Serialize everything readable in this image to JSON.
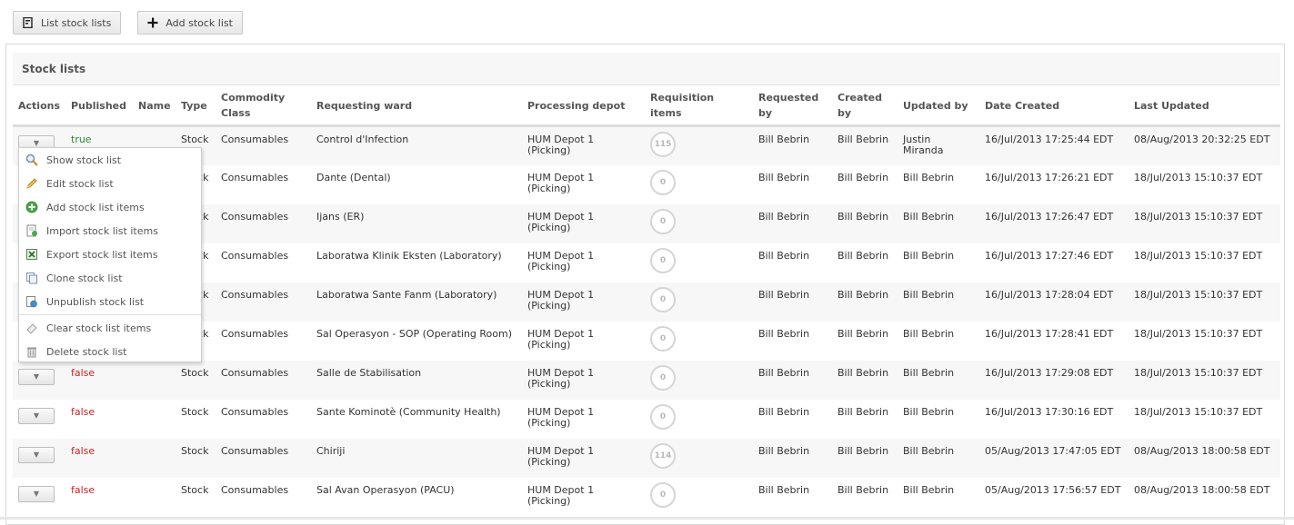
{
  "toolbar": {
    "list_label": "List stock lists",
    "add_label": "Add stock list"
  },
  "panel": {
    "title": "Stock lists"
  },
  "columns": {
    "actions": "Actions",
    "published": "Published",
    "name": "Name",
    "type": "Type",
    "commodity_class": "Commodity Class",
    "requesting_ward": "Requesting ward",
    "processing_depot": "Processing depot",
    "requisition_items": "Requisition items",
    "requested_by": "Requested by",
    "created_by": "Created by",
    "updated_by": "Updated by",
    "date_created": "Date Created",
    "last_updated": "Last Updated"
  },
  "rows": [
    {
      "published": "true",
      "name": "",
      "type": "Stock",
      "commodity": "Consumables",
      "ward": "Control d'Infection",
      "depot": "HUM Depot 1 (Picking)",
      "items": "115",
      "requested_by": "Bill Bebrin",
      "created_by": "Bill Bebrin",
      "updated_by": "Justin Miranda",
      "date_created": "16/Jul/2013 17:25:44 EDT",
      "last_updated": "08/Aug/2013 20:32:25 EDT"
    },
    {
      "published": "true",
      "name": "",
      "type": "Stock",
      "commodity": "Consumables",
      "ward": "Dante (Dental)",
      "depot": "HUM Depot 1 (Picking)",
      "items": "0",
      "requested_by": "Bill Bebrin",
      "created_by": "Bill Bebrin",
      "updated_by": "Bill Bebrin",
      "date_created": "16/Jul/2013 17:26:21 EDT",
      "last_updated": "18/Jul/2013 15:10:37 EDT"
    },
    {
      "published": "true",
      "name": "",
      "type": "Stock",
      "commodity": "Consumables",
      "ward": "Ijans (ER)",
      "depot": "HUM Depot 1 (Picking)",
      "items": "0",
      "requested_by": "Bill Bebrin",
      "created_by": "Bill Bebrin",
      "updated_by": "Bill Bebrin",
      "date_created": "16/Jul/2013 17:26:47 EDT",
      "last_updated": "18/Jul/2013 15:10:37 EDT"
    },
    {
      "published": "true",
      "name": "",
      "type": "Stock",
      "commodity": "Consumables",
      "ward": "Laboratwa Klinik Eksten (Laboratory)",
      "depot": "HUM Depot 1 (Picking)",
      "items": "0",
      "requested_by": "Bill Bebrin",
      "created_by": "Bill Bebrin",
      "updated_by": "Bill Bebrin",
      "date_created": "16/Jul/2013 17:27:46 EDT",
      "last_updated": "18/Jul/2013 15:10:37 EDT"
    },
    {
      "published": "true",
      "name": "",
      "type": "Stock",
      "commodity": "Consumables",
      "ward": "Laboratwa Sante Fanm (Laboratory)",
      "depot": "HUM Depot 1 (Picking)",
      "items": "0",
      "requested_by": "Bill Bebrin",
      "created_by": "Bill Bebrin",
      "updated_by": "Bill Bebrin",
      "date_created": "16/Jul/2013 17:28:04 EDT",
      "last_updated": "18/Jul/2013 15:10:37 EDT"
    },
    {
      "published": "true",
      "name": "",
      "type": "Stock",
      "commodity": "Consumables",
      "ward": "Sal Operasyon - SOP (Operating Room)",
      "depot": "HUM Depot 1 (Picking)",
      "items": "0",
      "requested_by": "Bill Bebrin",
      "created_by": "Bill Bebrin",
      "updated_by": "Bill Bebrin",
      "date_created": "16/Jul/2013 17:28:41 EDT",
      "last_updated": "18/Jul/2013 15:10:37 EDT"
    },
    {
      "published": "false",
      "name": "",
      "type": "Stock",
      "commodity": "Consumables",
      "ward": "Salle de Stabilisation",
      "depot": "HUM Depot 1 (Picking)",
      "items": "0",
      "requested_by": "Bill Bebrin",
      "created_by": "Bill Bebrin",
      "updated_by": "Bill Bebrin",
      "date_created": "16/Jul/2013 17:29:08 EDT",
      "last_updated": "18/Jul/2013 15:10:37 EDT"
    },
    {
      "published": "false",
      "name": "",
      "type": "Stock",
      "commodity": "Consumables",
      "ward": "Sante Kominotè (Community Health)",
      "depot": "HUM Depot 1 (Picking)",
      "items": "0",
      "requested_by": "Bill Bebrin",
      "created_by": "Bill Bebrin",
      "updated_by": "Bill Bebrin",
      "date_created": "16/Jul/2013 17:30:16 EDT",
      "last_updated": "18/Jul/2013 15:10:37 EDT"
    },
    {
      "published": "false",
      "name": "",
      "type": "Stock",
      "commodity": "Consumables",
      "ward": "Chiriji",
      "depot": "HUM Depot 1 (Picking)",
      "items": "114",
      "requested_by": "Bill Bebrin",
      "created_by": "Bill Bebrin",
      "updated_by": "Bill Bebrin",
      "date_created": "05/Aug/2013 17:47:05 EDT",
      "last_updated": "08/Aug/2013 18:00:58 EDT"
    },
    {
      "published": "false",
      "name": "",
      "type": "Stock",
      "commodity": "Consumables",
      "ward": "Sal Avan Operasyon (PACU)",
      "depot": "HUM Depot 1 (Picking)",
      "items": "0",
      "requested_by": "Bill Bebrin",
      "created_by": "Bill Bebrin",
      "updated_by": "Bill Bebrin",
      "date_created": "05/Aug/2013 17:56:57 EDT",
      "last_updated": "08/Aug/2013 18:00:58 EDT"
    }
  ],
  "menu": {
    "items": [
      {
        "label": "Show stock list",
        "icon": "magnifier-icon"
      },
      {
        "label": "Edit stock list",
        "icon": "pencil-icon"
      },
      {
        "label": "Add stock list items",
        "icon": "add-circle-icon"
      },
      {
        "label": "Import stock list items",
        "icon": "import-icon"
      },
      {
        "label": "Export stock list items",
        "icon": "export-icon"
      },
      {
        "label": "Clone stock list",
        "icon": "clone-icon"
      },
      {
        "label": "Unpublish stock list",
        "icon": "unpublish-icon"
      }
    ],
    "danger_items": [
      {
        "label": "Clear stock list items",
        "icon": "eraser-icon"
      },
      {
        "label": "Delete stock list",
        "icon": "trash-icon"
      }
    ]
  },
  "colors": {
    "true": "#2e8b2e",
    "false": "#cc2222",
    "stripe": "#f7f7f7"
  }
}
